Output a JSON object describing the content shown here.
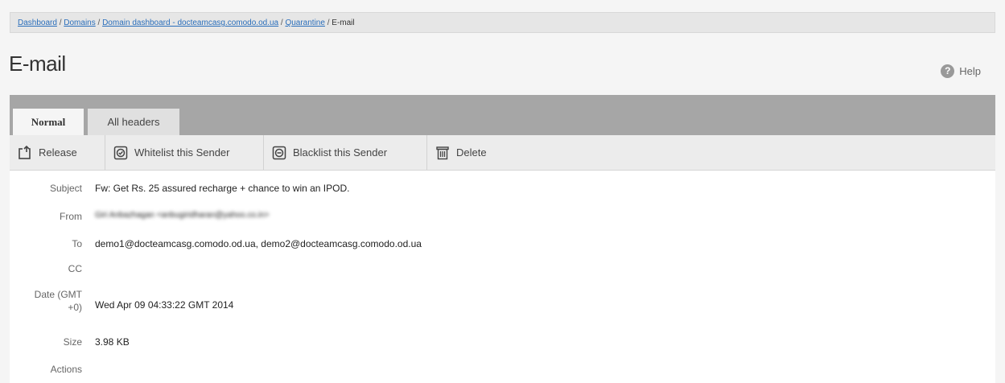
{
  "breadcrumb": {
    "items": [
      "Dashboard",
      "Domains",
      "Domain dashboard - docteamcasg.comodo.od.ua",
      "Quarantine"
    ],
    "current": "E-mail",
    "separator": "/"
  },
  "page": {
    "title": "E-mail",
    "help_label": "Help",
    "help_icon": "?"
  },
  "tabs": [
    {
      "label": "Normal",
      "active": true
    },
    {
      "label": "All headers",
      "active": false
    }
  ],
  "toolbar": {
    "release": "Release",
    "whitelist": "Whitelist this Sender",
    "blacklist": "Blacklist this Sender",
    "delete": "Delete"
  },
  "details": {
    "subject_label": "Subject",
    "subject": "Fw: Get Rs. 25 assured recharge + chance to win an IPOD.",
    "from_label": "From",
    "from": "Giri Anbazhagan <anbugiridharan@yahoo.co.in>",
    "to_label": "To",
    "to": "demo1@docteamcasg.comodo.od.ua, demo2@docteamcasg.comodo.od.ua",
    "cc_label": "CC",
    "cc": "",
    "date_label_1": "Date (GMT",
    "date_label_2": "+0)",
    "date": "Wed Apr 09 04:33:22 GMT 2014",
    "size_label": "Size",
    "size": "3.98 KB",
    "actions_label": "Actions"
  },
  "colors": {
    "link": "#2a6ebb",
    "tabbar": "#a6a6a6",
    "toolbar": "#ececec"
  }
}
